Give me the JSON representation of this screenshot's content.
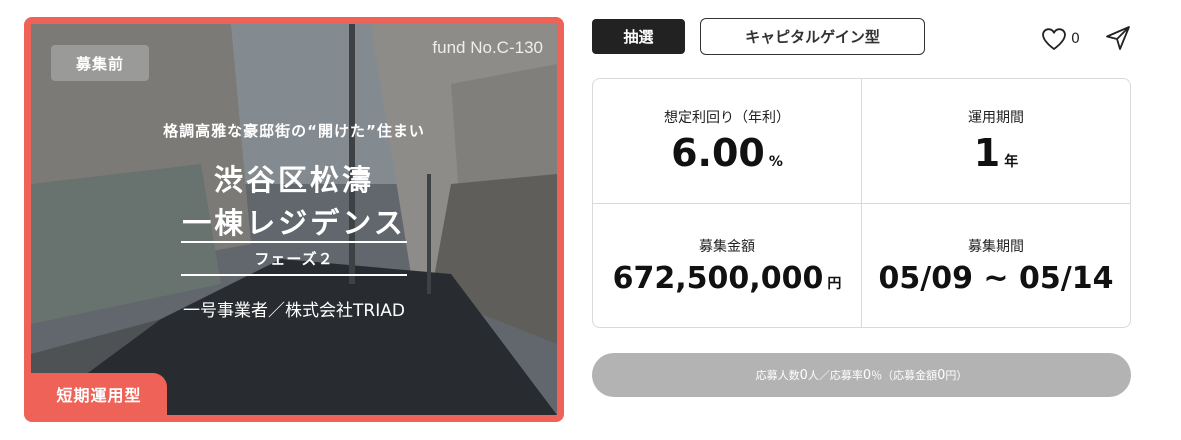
{
  "card": {
    "status_badge": "募集前",
    "fund_no": "fund No.C-130",
    "catch_copy": "格調高雅な豪邸街の“開けた”住まい",
    "title_line1": "渋谷区松濤",
    "title_line2": "一棟レジデンス",
    "phase": "フェーズ２",
    "operator": "一号事業者／株式会社TRIAD",
    "type_badge": "短期運用型",
    "accent_color": "#ee6257"
  },
  "tags": {
    "lottery": "抽選",
    "investment_type": "キャピタルゲイン型"
  },
  "actions": {
    "like_count": "0",
    "like_icon": "heart-icon",
    "share_icon": "send-icon"
  },
  "stats": {
    "yield": {
      "label": "想定利回り（年利）",
      "value": "6.00",
      "unit": "%"
    },
    "period": {
      "label": "運用期間",
      "value": "1",
      "unit": "年"
    },
    "amount": {
      "label": "募集金額",
      "value": "672,500,000",
      "unit": "円"
    },
    "recruit_period": {
      "label": "募集期間",
      "value": "05/09 ~ 05/14"
    }
  },
  "apply": {
    "t1": "応募人数",
    "applicants": "0",
    "t2": "人／応募率",
    "rate": "0",
    "t3": "％（応募金額",
    "amount": "0",
    "t4": "円）"
  }
}
